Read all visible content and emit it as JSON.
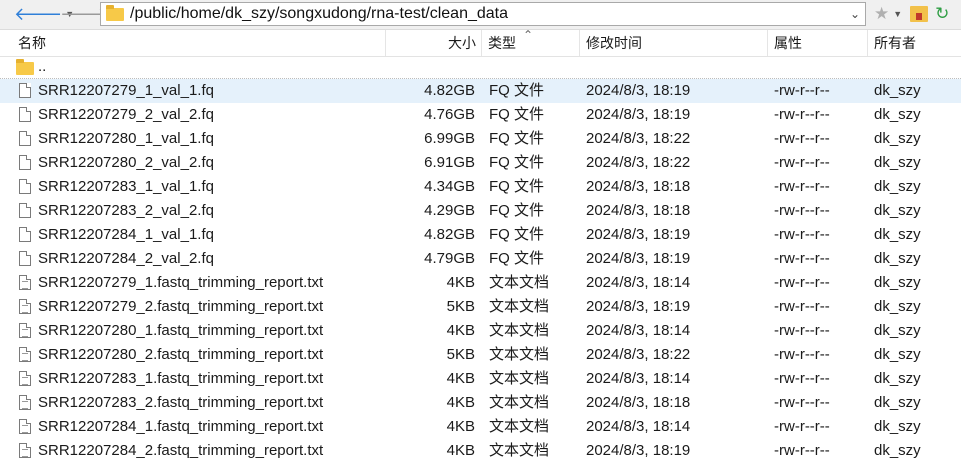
{
  "toolbar": {
    "back_icon": "back-arrow-icon",
    "forward_icon": "forward-arrow-icon",
    "path": "/public/home/dk_szy/songxudong/rna-test/clean_data"
  },
  "columns": {
    "name": "名称",
    "size": "大小",
    "type": "类型",
    "mtime": "修改时间",
    "perm": "属性",
    "owner": "所有者"
  },
  "parent": {
    "label": ".."
  },
  "files": [
    {
      "name": "SRR12207279_1_val_1.fq",
      "size": "4.82GB",
      "type": "FQ 文件",
      "mtime": "2024/8/3, 18:19",
      "perm": "-rw-r--r--",
      "owner": "dk_szy"
    },
    {
      "name": "SRR12207279_2_val_2.fq",
      "size": "4.76GB",
      "type": "FQ 文件",
      "mtime": "2024/8/3, 18:19",
      "perm": "-rw-r--r--",
      "owner": "dk_szy"
    },
    {
      "name": "SRR12207280_1_val_1.fq",
      "size": "6.99GB",
      "type": "FQ 文件",
      "mtime": "2024/8/3, 18:22",
      "perm": "-rw-r--r--",
      "owner": "dk_szy"
    },
    {
      "name": "SRR12207280_2_val_2.fq",
      "size": "6.91GB",
      "type": "FQ 文件",
      "mtime": "2024/8/3, 18:22",
      "perm": "-rw-r--r--",
      "owner": "dk_szy"
    },
    {
      "name": "SRR12207283_1_val_1.fq",
      "size": "4.34GB",
      "type": "FQ 文件",
      "mtime": "2024/8/3, 18:18",
      "perm": "-rw-r--r--",
      "owner": "dk_szy"
    },
    {
      "name": "SRR12207283_2_val_2.fq",
      "size": "4.29GB",
      "type": "FQ 文件",
      "mtime": "2024/8/3, 18:18",
      "perm": "-rw-r--r--",
      "owner": "dk_szy"
    },
    {
      "name": "SRR12207284_1_val_1.fq",
      "size": "4.82GB",
      "type": "FQ 文件",
      "mtime": "2024/8/3, 18:19",
      "perm": "-rw-r--r--",
      "owner": "dk_szy"
    },
    {
      "name": "SRR12207284_2_val_2.fq",
      "size": "4.79GB",
      "type": "FQ 文件",
      "mtime": "2024/8/3, 18:19",
      "perm": "-rw-r--r--",
      "owner": "dk_szy"
    },
    {
      "name": "SRR12207279_1.fastq_trimming_report.txt",
      "size": "4KB",
      "type": "文本文档",
      "mtime": "2024/8/3, 18:14",
      "perm": "-rw-r--r--",
      "owner": "dk_szy"
    },
    {
      "name": "SRR12207279_2.fastq_trimming_report.txt",
      "size": "5KB",
      "type": "文本文档",
      "mtime": "2024/8/3, 18:19",
      "perm": "-rw-r--r--",
      "owner": "dk_szy"
    },
    {
      "name": "SRR12207280_1.fastq_trimming_report.txt",
      "size": "4KB",
      "type": "文本文档",
      "mtime": "2024/8/3, 18:14",
      "perm": "-rw-r--r--",
      "owner": "dk_szy"
    },
    {
      "name": "SRR12207280_2.fastq_trimming_report.txt",
      "size": "5KB",
      "type": "文本文档",
      "mtime": "2024/8/3, 18:22",
      "perm": "-rw-r--r--",
      "owner": "dk_szy"
    },
    {
      "name": "SRR12207283_1.fastq_trimming_report.txt",
      "size": "4KB",
      "type": "文本文档",
      "mtime": "2024/8/3, 18:14",
      "perm": "-rw-r--r--",
      "owner": "dk_szy"
    },
    {
      "name": "SRR12207283_2.fastq_trimming_report.txt",
      "size": "4KB",
      "type": "文本文档",
      "mtime": "2024/8/3, 18:18",
      "perm": "-rw-r--r--",
      "owner": "dk_szy"
    },
    {
      "name": "SRR12207284_1.fastq_trimming_report.txt",
      "size": "4KB",
      "type": "文本文档",
      "mtime": "2024/8/3, 18:14",
      "perm": "-rw-r--r--",
      "owner": "dk_szy"
    },
    {
      "name": "SRR12207284_2.fastq_trimming_report.txt",
      "size": "4KB",
      "type": "文本文档",
      "mtime": "2024/8/3, 18:19",
      "perm": "-rw-r--r--",
      "owner": "dk_szy"
    }
  ],
  "selected_index": 0,
  "colors": {
    "selection": "#e5f1fb",
    "accent": "#2f7fd8",
    "folder": "#f7c948"
  }
}
